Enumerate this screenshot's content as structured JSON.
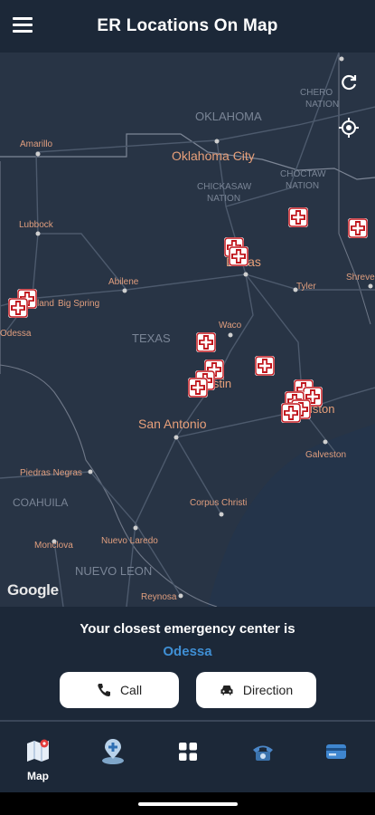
{
  "header": {
    "title": "ER Locations On Map",
    "menu_icon": "hamburger-menu-icon"
  },
  "map": {
    "google_attribution": "Google",
    "labels": {
      "oklahoma": "OKLAHOMA",
      "oklahoma_city": "Oklahoma City",
      "cherokee_1": "CHERO",
      "cherokee_2": "NATION",
      "chickasaw_1": "CHICKASAW",
      "chickasaw_2": "NATION",
      "choctaw_1": "CHOCTAW",
      "choctaw_2": "NATION",
      "amarillo": "Amarillo",
      "lubbock": "Lubbock",
      "abilene": "Abilene",
      "big_spring": "Big Spring",
      "odessa": "Odessa",
      "dallas": "Dallas",
      "tyler": "Tyler",
      "shreveport": "Shreve",
      "waco": "Waco",
      "texas": "TEXAS",
      "austin": "Austin",
      "san_antonio": "San Antonio",
      "houston": "Houston",
      "galveston": "Galveston",
      "piedras_negras": "Piedras Negras",
      "coahuila": "COAHUILA",
      "corpus_christi": "Corpus Christi",
      "monclova": "Monclova",
      "nuevo_laredo": "Nuevo Laredo",
      "nuevo_leon": "NUEVO LEON",
      "reynosa": "Reynosa",
      "midland": "land"
    },
    "controls": {
      "refresh_icon": "refresh-icon",
      "locate_icon": "my-location-icon"
    },
    "marker_icon": "er-cross-marker-icon"
  },
  "panel": {
    "closest_text": "Your closest emergency center is",
    "closest_city": "Odessa",
    "call_label": "Call",
    "direction_label": "Direction",
    "accent": "#3f8fd4"
  },
  "nav": {
    "items": [
      {
        "label": "Map",
        "icon": "map-icon"
      },
      {
        "label": "",
        "icon": "hospital-location-icon"
      },
      {
        "label": "",
        "icon": "grid-icon"
      },
      {
        "label": "",
        "icon": "telephone-icon"
      },
      {
        "label": "",
        "icon": "card-icon"
      }
    ]
  }
}
